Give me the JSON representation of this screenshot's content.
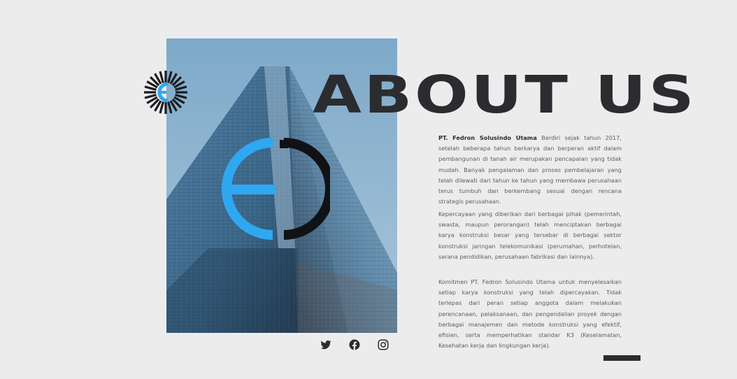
{
  "header": {
    "title": "ABOUT US"
  },
  "about": {
    "company_name": "PT. Fedron Solusindo Utama",
    "paragraph1_rest": " Berdiri sejak tahun 2017, setelah beberapa tahun berkarya dan berperan aktif dalam pembangunan di tanah air merupakan pencapaian yang tidak mudah. Banyak pengalaman dan proses pembelajaran yang telah dilewati dari tahun ke tahun yang membawa perusahaan terus tumbuh dan berkembang sesuai dengan rencana strategis perusahaan.",
    "paragraph2": "Kepercayaan yang diberikan dari berbagai pihak (pemerintah, swasta, maupun perorangan) telah menciptakan berbagai karya konstruksi besar yang tersebar di berbagai sektor konstruksi jaringan telekomunikasi (perumahan, perhotelan, sarana pendidikan, perusahaan fabrikasi dan lainnya).",
    "paragraph3": "Komitmen PT. Fedron Solusindo Utama untuk menyelesaikan setiap karya konstruksi yang telah dipercayakan. Tidak terlepas dari peran setiap anggota dalam melakukan perencanaan, pelaksanaan, dan pengendalian proyek dengan berbagai manajemen dan metode konstruksi yang efektif, efisien, serta memperhatikan standar K3 (Keselamatan, Kesehatan kerja dan lingkungan kerja)."
  },
  "social": {
    "icons": [
      "twitter-icon",
      "facebook-icon",
      "instagram-icon"
    ]
  },
  "colors": {
    "background": "#ececec",
    "text_dark": "#2b2c30",
    "accent_blue": "#2fa8f2",
    "body_text": "#5d5e62"
  }
}
